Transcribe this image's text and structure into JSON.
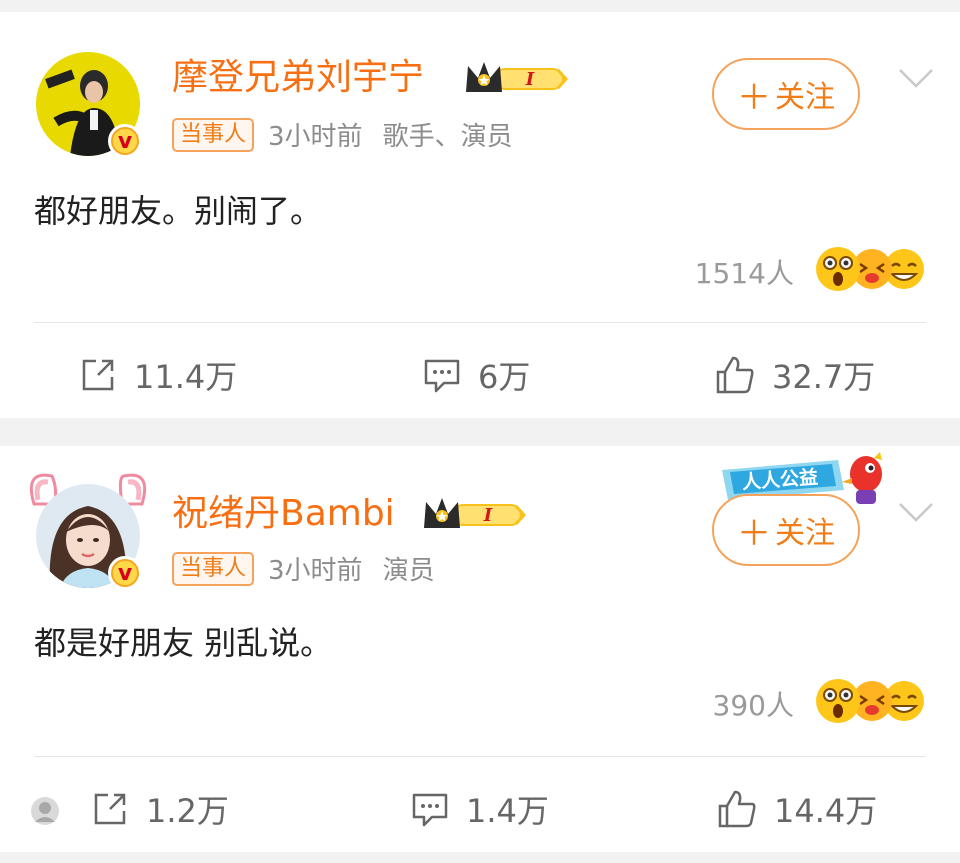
{
  "posts": [
    {
      "author": "摩登兄弟刘宇宁",
      "level": "I",
      "tag": "当事人",
      "time": "3小时前",
      "role": "歌手、演员",
      "follow_label": "关注",
      "follow_plus": "＋",
      "content": "都好朋友。别闹了。",
      "reaction_count": "1514人",
      "actions": {
        "share": "11.4万",
        "comment": "6万",
        "like": "32.7万"
      }
    },
    {
      "author": "祝绪丹Bambi",
      "level": "I",
      "tag": "当事人",
      "time": "3小时前",
      "role": "演员",
      "follow_label": "关注",
      "follow_plus": "＋",
      "content": "都是好朋友 别乱说。",
      "reaction_count": "390人",
      "banner_text": "人人公益",
      "actions": {
        "share": "1.2万",
        "comment": "1.4万",
        "like": "14.4万"
      }
    }
  ],
  "colors": {
    "accent": "#f76f13",
    "follow_border": "#f5a35c",
    "muted": "#8c8c8c"
  },
  "icons": [
    "share-icon",
    "comment-icon",
    "like-icon",
    "chevron-down-icon",
    "crown-icon",
    "verified-icon"
  ]
}
